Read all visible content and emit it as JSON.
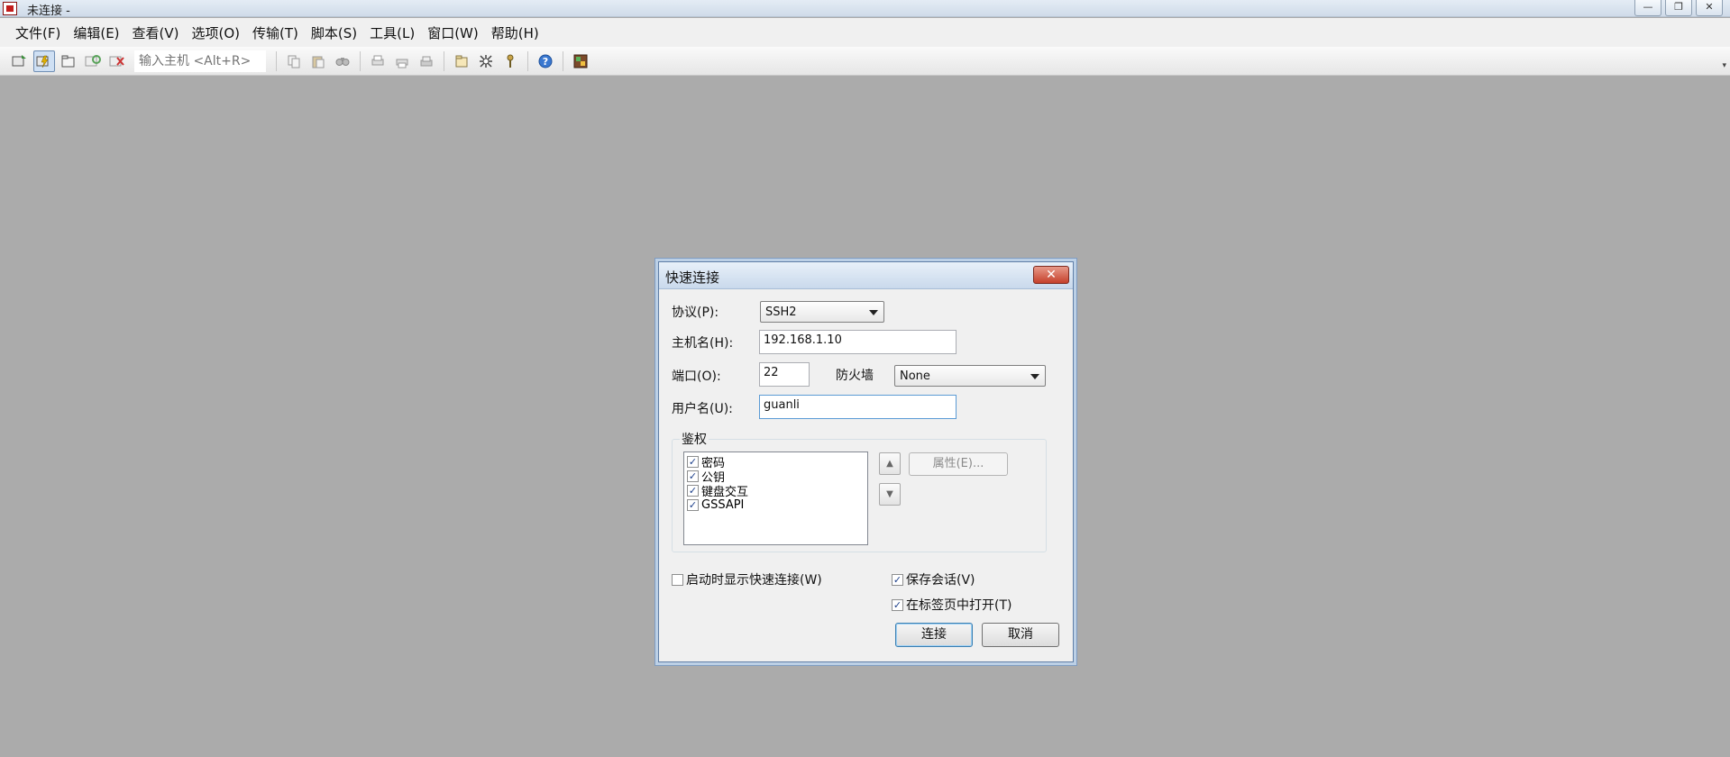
{
  "window": {
    "title": "未连接 -",
    "buttons": {
      "minimize": "—",
      "restore": "❐",
      "close": "✕"
    }
  },
  "menu": [
    "文件(F)",
    "编辑(E)",
    "查看(V)",
    "选项(O)",
    "传输(T)",
    "脚本(S)",
    "工具(L)",
    "窗口(W)",
    "帮助(H)"
  ],
  "toolbar": {
    "host_placeholder": "输入主机 <Alt+R>",
    "overflow": "▾",
    "icons": [
      "connect-icon",
      "quick-connect-icon",
      "connect-in-tab-icon",
      "reconnect-icon",
      "disconnect-icon",
      "copy-icon",
      "paste-icon",
      "find-icon",
      "print-setup-icon",
      "print-icon",
      "print-screen-icon",
      "session-options-icon",
      "global-options-icon",
      "keymap-icon",
      "help-icon",
      "sftp-icon"
    ]
  },
  "dialog": {
    "title": "快速连接",
    "close_glyph": "✕",
    "protocol": {
      "label": "协议(P):",
      "value": "SSH2"
    },
    "hostname": {
      "label": "主机名(H):",
      "value": "192.168.1.10"
    },
    "port": {
      "label": "端口(O):",
      "value": "22"
    },
    "firewall": {
      "label": "防火墙",
      "value": "None"
    },
    "username": {
      "label": "用户名(U):",
      "value": "guanli"
    },
    "auth": {
      "label": "鉴权",
      "methods": [
        {
          "name": "密码",
          "checked": true
        },
        {
          "name": "公钥",
          "checked": true
        },
        {
          "name": "键盘交互",
          "checked": true
        },
        {
          "name": "GSSAPI",
          "checked": true
        }
      ],
      "properties_button": "属性(E)..."
    },
    "show_on_startup": {
      "label": "启动时显示快速连接(W)",
      "checked": false
    },
    "save_session": {
      "label": "保存会话(V)",
      "checked": true
    },
    "open_in_tab": {
      "label": "在标签页中打开(T)",
      "checked": true
    },
    "connect_button": "连接",
    "cancel_button": "取消",
    "check_glyph": "✓"
  }
}
